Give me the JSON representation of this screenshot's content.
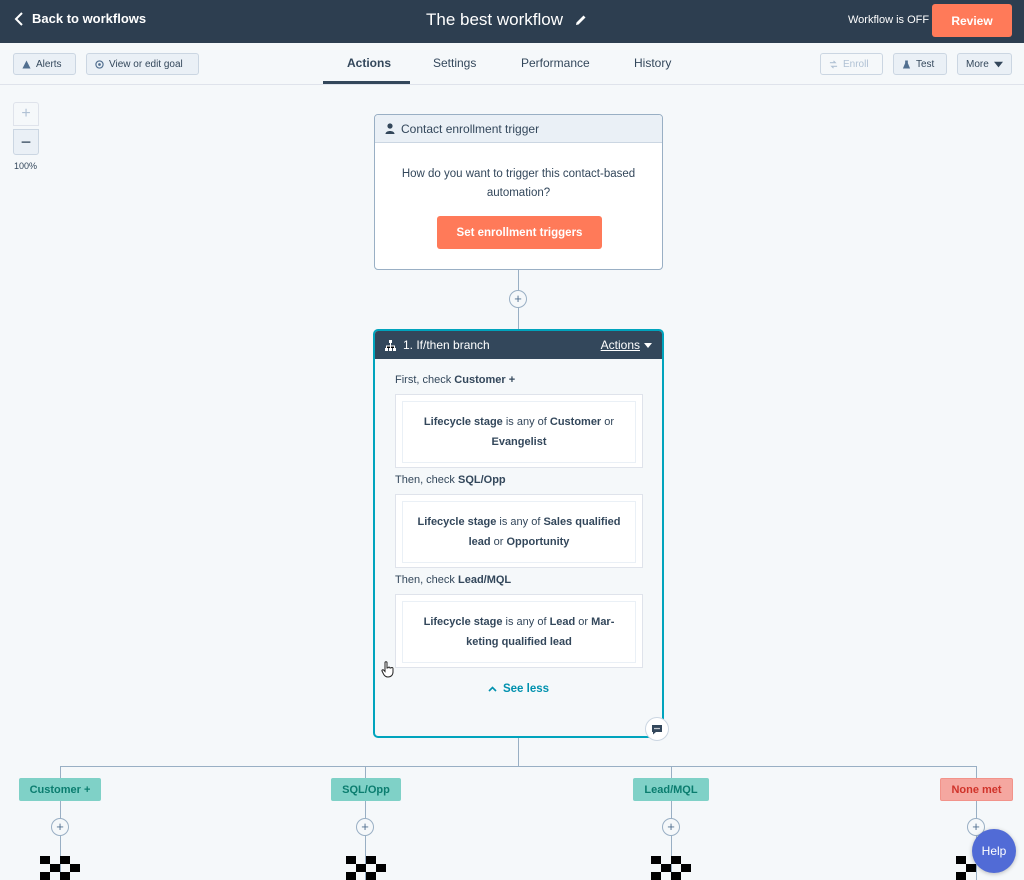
{
  "topbar": {
    "back_label": "Back to workflows",
    "workflow_title": "The best workflow",
    "status": "Workflow is OFF",
    "review_label": "Review"
  },
  "toolbar": {
    "alerts_label": "Alerts",
    "goal_label": "View or edit goal",
    "enroll_label": "Enroll",
    "test_label": "Test",
    "more_label": "More"
  },
  "tabs": [
    {
      "label": "Actions",
      "active": true
    },
    {
      "label": "Settings",
      "active": false
    },
    {
      "label": "Performance",
      "active": false
    },
    {
      "label": "History",
      "active": false
    }
  ],
  "zoom": {
    "plus": "+",
    "minus": "−",
    "level": "100%"
  },
  "trigger": {
    "title": "Contact enrollment trigger",
    "question": "How do you want to trigger this contact-based automation?",
    "button_label": "Set enrollment triggers"
  },
  "add_step": "+",
  "branch": {
    "title": "1. If/then branch",
    "actions_label": "Actions",
    "checks": [
      {
        "prefix": "First, check ",
        "name": "Customer +",
        "condition": {
          "property": "Lifecycle stage",
          "op": " is any of ",
          "v1": "Customer",
          "join": " or ",
          "v2": "Evangelist"
        }
      },
      {
        "prefix": "Then, check ",
        "name": "SQL/Opp",
        "condition": {
          "property": "Lifecycle stage",
          "op": " is any of ",
          "v1": "Sales qualified lead",
          "join": " or ",
          "v2": "Opportunity"
        }
      },
      {
        "prefix": "Then, check ",
        "name": "Lead/MQL",
        "condition": {
          "property": "Lifecycle stage",
          "op": " is any of ",
          "v1": "Lead",
          "join": " or ",
          "v2": "Mar-keting qualified lead"
        }
      }
    ],
    "see_less_label": "See less"
  },
  "branch_labels": [
    {
      "label": "Customer +",
      "status": "teal"
    },
    {
      "label": "SQL/Opp",
      "status": "teal"
    },
    {
      "label": "Lead/MQL",
      "status": "teal"
    },
    {
      "label": "None met",
      "status": "red"
    }
  ],
  "help_label": "Help",
  "colors": {
    "topbar": "#2d3e50",
    "accent_orange": "#ff7a59",
    "branch_border": "#00a4bd",
    "branch_label_bg": "#7fd1c7",
    "none_met_bg": "#f5a7a0"
  }
}
